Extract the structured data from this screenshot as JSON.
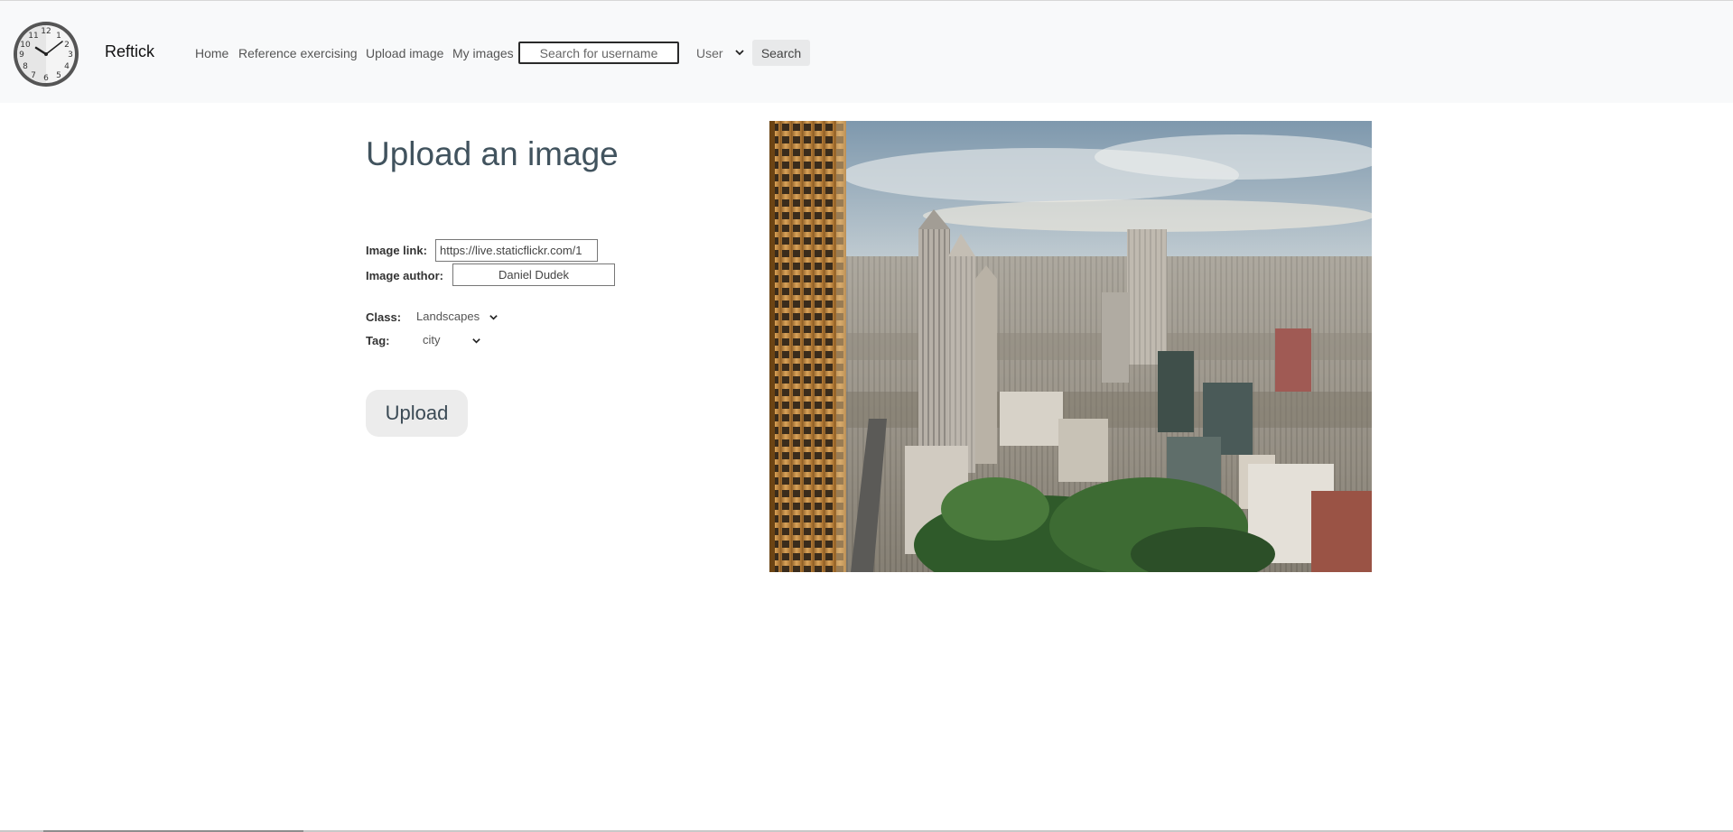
{
  "navbar": {
    "brand": "Reftick",
    "links": [
      {
        "label": "Home"
      },
      {
        "label": "Reference exercising"
      },
      {
        "label": "Upload image"
      },
      {
        "label": "My images"
      }
    ],
    "search_placeholder": "Search for username",
    "search_value": "",
    "search_type": "User",
    "search_button": "Search",
    "logo_icon": "clock-icon",
    "clock_numerals": [
      "12",
      "1",
      "2",
      "3",
      "4",
      "5",
      "6",
      "7",
      "8",
      "9",
      "10",
      "11"
    ]
  },
  "form": {
    "title": "Upload an image",
    "image_link_label": "Image link:",
    "image_link_value": "https://live.staticflickr.com/1",
    "image_author_label": "Image author:",
    "image_author_value": "Daniel Dudek",
    "class_label": "Class:",
    "class_value": "Landscapes",
    "tag_label": "Tag:",
    "tag_value": "city",
    "upload_button": "Upload"
  },
  "preview": {
    "icon": "city-skyline-photo"
  },
  "colors": {
    "navbar_bg": "#f8f9fa",
    "title": "#41535e",
    "button_bg": "#ececec"
  }
}
